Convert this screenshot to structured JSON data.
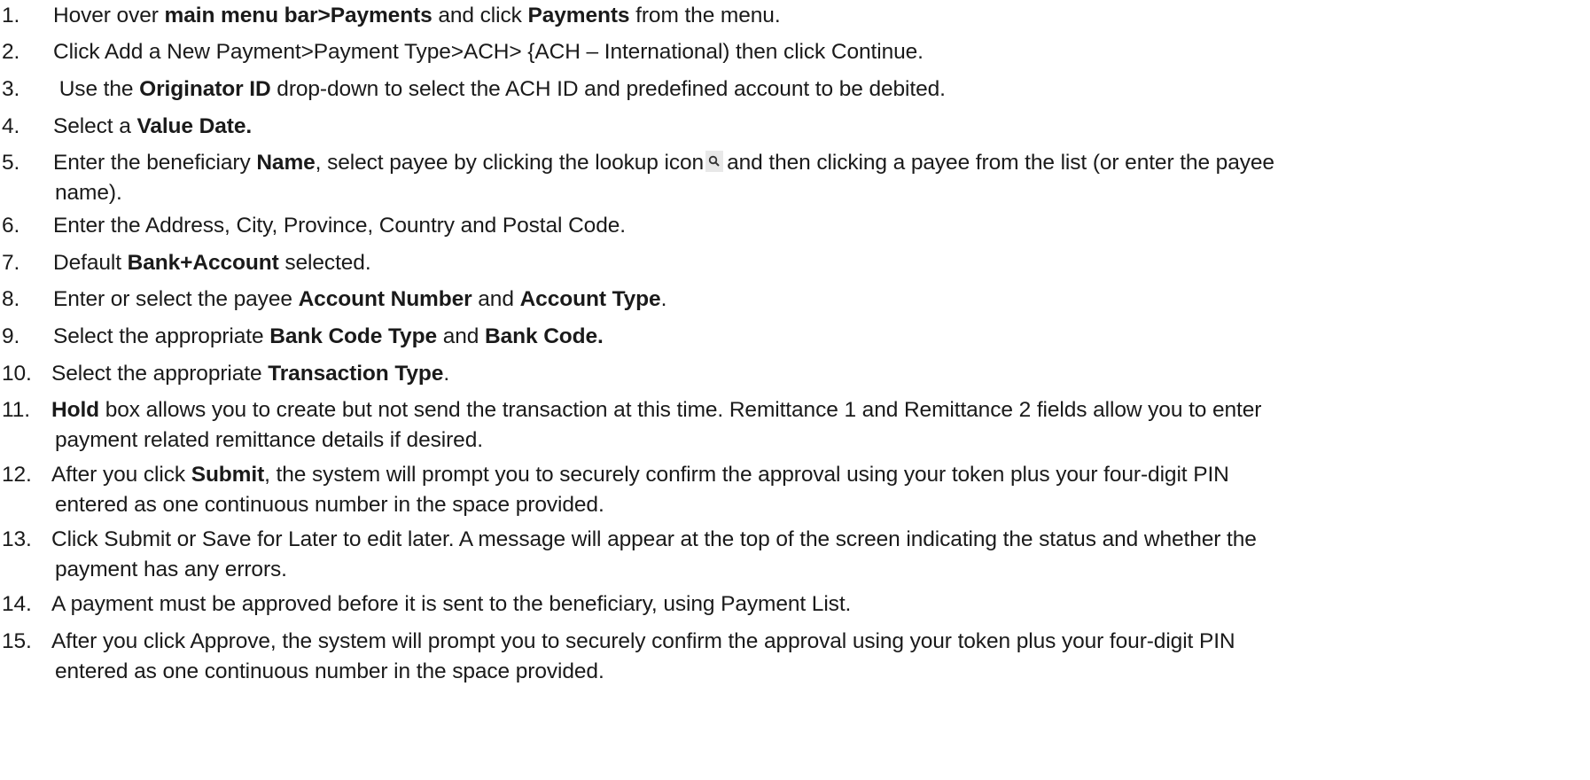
{
  "steps": [
    {
      "num": "1.",
      "parts": [
        "Hover over ",
        "main menu bar>Payments",
        " and click ",
        "Payments",
        " from the menu."
      ]
    },
    {
      "num": "2.",
      "text": "Click Add a New Payment>Payment Type>ACH> {ACH – International) then click Continue."
    },
    {
      "num": "3.",
      "parts": [
        " Use the ",
        "Originator ID",
        " drop-down to select the ACH ID and predefined account to be debited."
      ]
    },
    {
      "num": "4.",
      "parts": [
        "Select a ",
        "Value Date."
      ]
    },
    {
      "num": "5.",
      "parts": [
        "Enter the beneficiary ",
        "Name",
        ", select payee by clicking the lookup icon",
        "and then clicking a payee from the list (or enter the payee"
      ],
      "line2": "name)."
    },
    {
      "num": "6.",
      "text": "Enter the Address, City, Province, Country and Postal Code."
    },
    {
      "num": "7.",
      "parts": [
        "Default ",
        "Bank+Account",
        " selected."
      ]
    },
    {
      "num": "8.",
      "parts": [
        "Enter or select the payee ",
        "Account Number",
        " and ",
        "Account Type",
        "."
      ]
    },
    {
      "num": "9.",
      "parts": [
        "Select the appropriate ",
        "Bank Code Type",
        " and ",
        "Bank Code."
      ]
    },
    {
      "num": "10.",
      "parts": [
        "Select the appropriate ",
        "Transaction Type",
        "."
      ]
    },
    {
      "num": "11.",
      "parts": [
        "Hold",
        " box allows you to create but not send the transaction at this time. Remittance 1 and Remittance 2 fields allow you to enter"
      ],
      "line2": "payment related remittance details if desired."
    },
    {
      "num": "12.",
      "parts": [
        "After you click ",
        "Submit",
        ", the system will prompt you to securely confirm the approval using your token plus your four-digit PIN"
      ],
      "line2": "entered as one continuous number in the space provided."
    },
    {
      "num": "13.",
      "text": "Click Submit or Save for Later to edit later. A message will appear at the top of the screen indicating the status and whether the",
      "line2": "payment has any errors."
    },
    {
      "num": "14.",
      "text": "A payment must be approved before it is sent to the beneficiary, using Payment List."
    },
    {
      "num": "15.",
      "text": "After you click Approve, the system will prompt you to securely confirm the approval using your token plus your four-digit PIN",
      "line2": "entered as one continuous number in the space provided."
    }
  ],
  "icons": {
    "lookup": "magnifier-icon"
  }
}
